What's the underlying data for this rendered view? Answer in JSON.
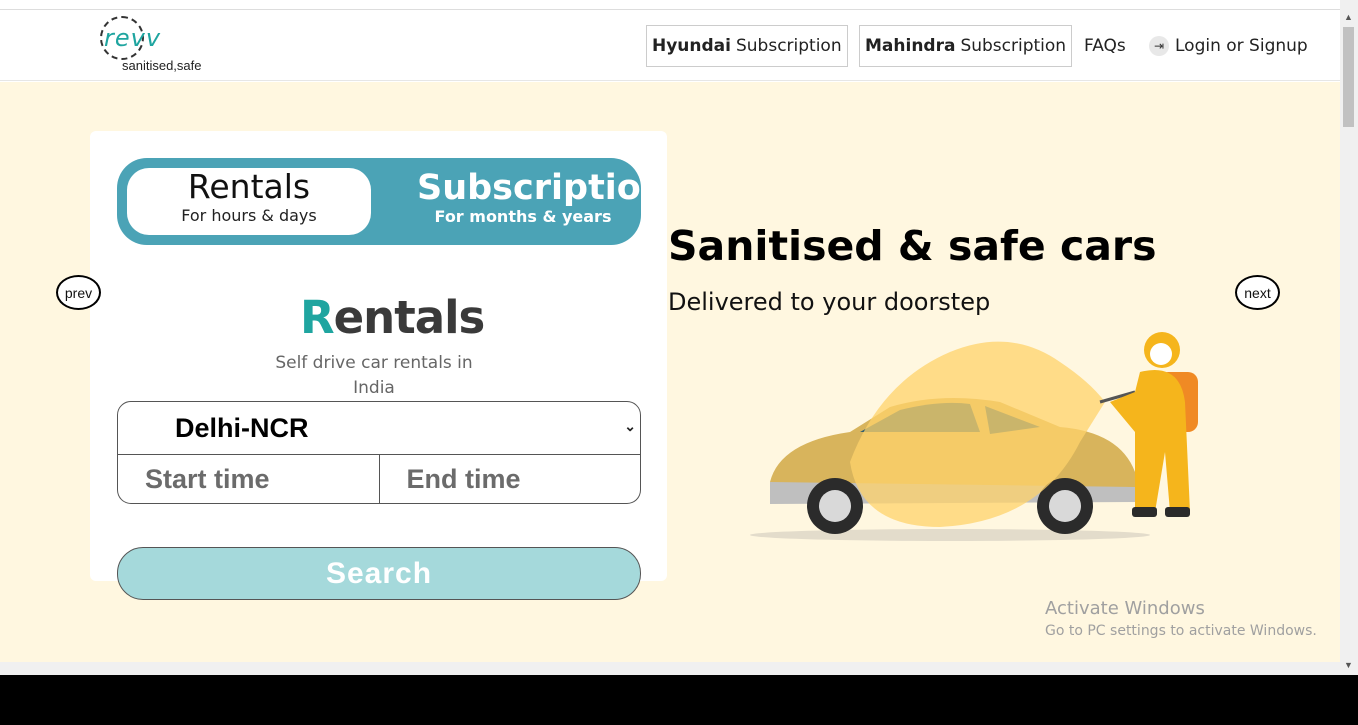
{
  "brand": {
    "logo_text": "revv",
    "tagline": "sanitised,safe",
    "color": "#1fa5a0"
  },
  "nav": {
    "hyundai": {
      "brand": "Hyundai",
      "label": "Subscription"
    },
    "mahindra": {
      "brand": "Mahindra",
      "label": "Subscription"
    },
    "faqs": "FAQs",
    "login": "Login or Signup",
    "login_icon": "login-arrow-icon"
  },
  "booking": {
    "tabs": {
      "rentals": {
        "title": "Rentals",
        "subtitle": "For hours & days"
      },
      "subscriptions": {
        "title": "Subscriptions",
        "subtitle": "For months & years"
      }
    },
    "section_logo": "Rentals",
    "section_logo_accent": "R",
    "description": "Self drive car rentals in India",
    "city": "Delhi-NCR",
    "start_time_placeholder": "Start time",
    "end_time_placeholder": "End time",
    "search_label": "Search"
  },
  "carousel": {
    "prev_label": "prev",
    "next_label": "next",
    "headline": "Sanitised & safe cars",
    "subheadline": "Delivered to your doorstep"
  },
  "watermark": {
    "line1": "Activate Windows",
    "line2": "Go to PC settings to activate Windows."
  },
  "colors": {
    "hero_bg": "#fff7e0",
    "toggle_bg": "#4ba3b6",
    "search_bg": "#a5d9db"
  }
}
